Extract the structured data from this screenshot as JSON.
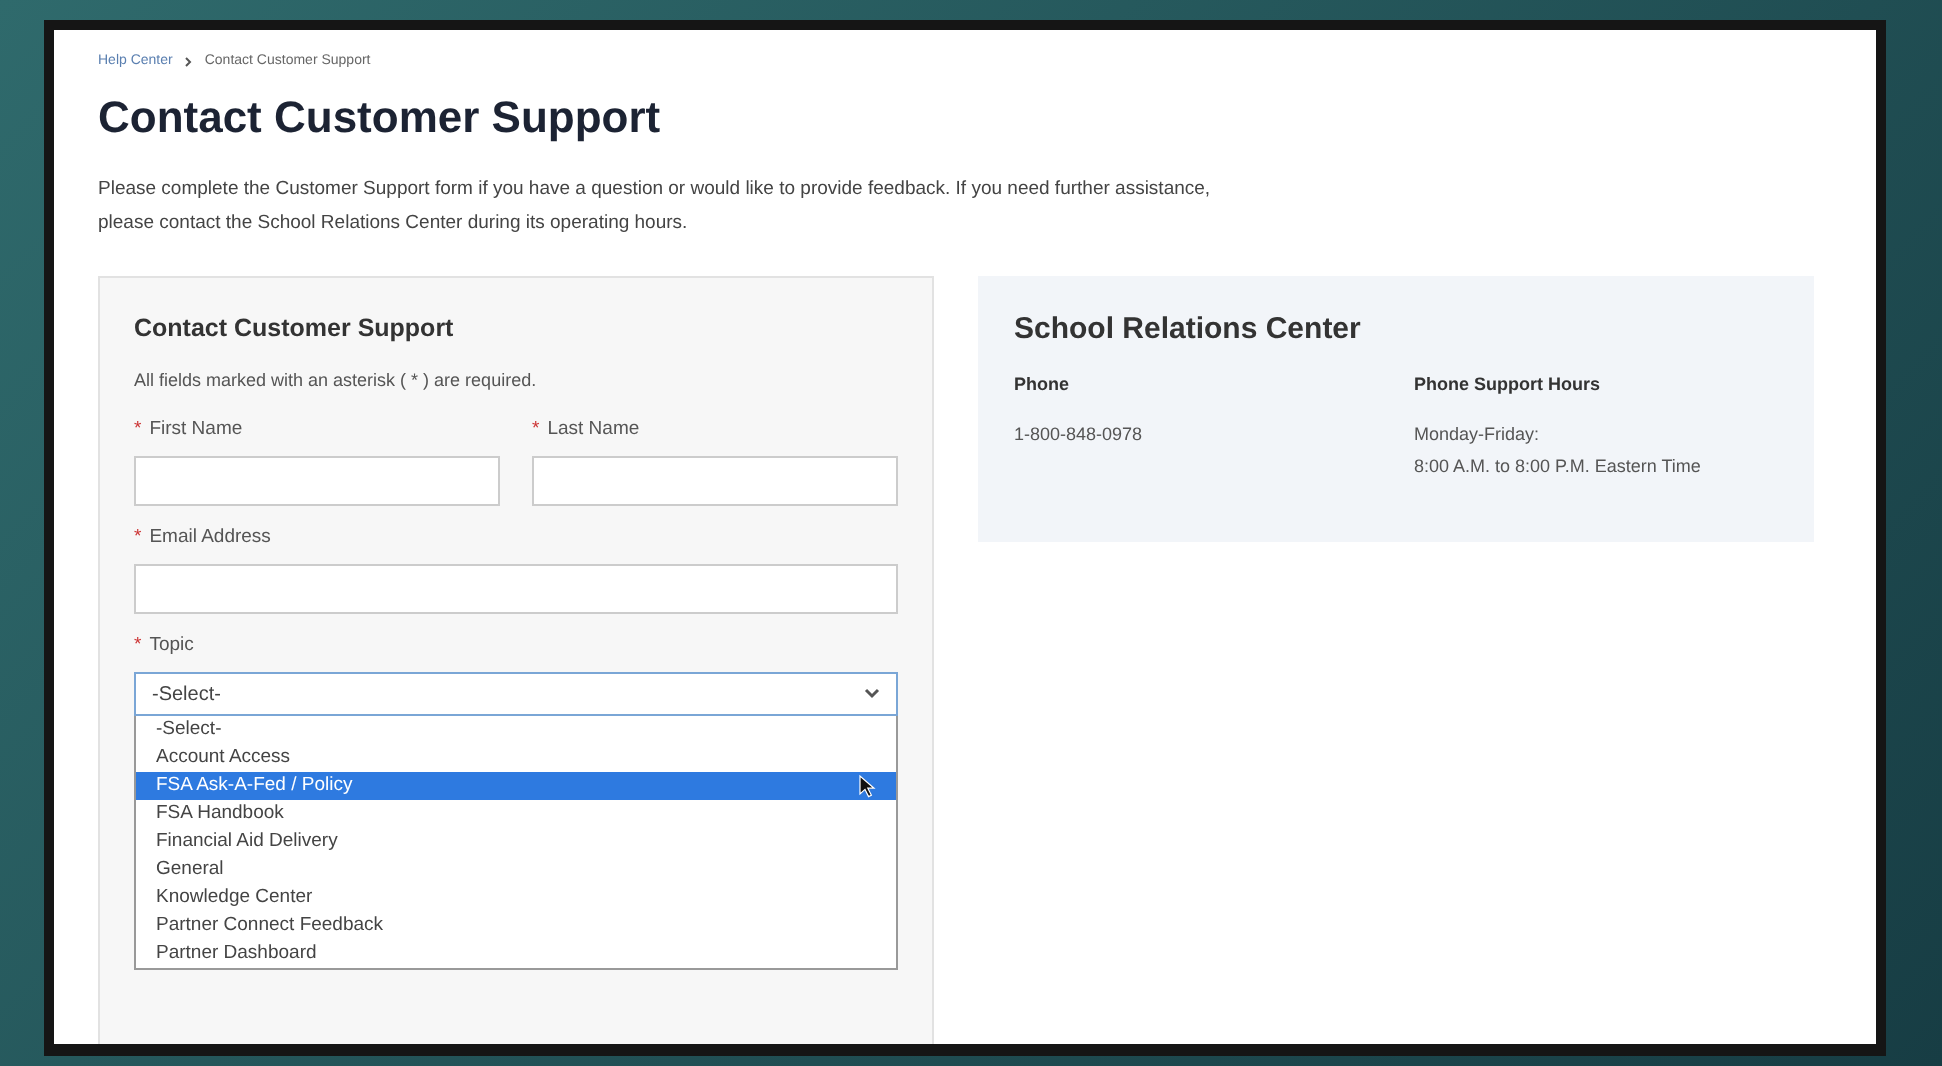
{
  "breadcrumb": [
    {
      "label": "Help Center",
      "kind": "link"
    },
    {
      "label": "Contact Customer Support",
      "kind": "current"
    }
  ],
  "title": "Contact Customer Support",
  "intro": "Please complete the Customer Support form if you have a question or would like to provide feedback. If you need further assistance, please contact the School Relations Center during its operating hours.",
  "form": {
    "title": "Contact Customer Support",
    "required_mark": "*",
    "note": "All fields marked with an asterisk ( * ) are required.",
    "fields": [
      {
        "label": "First Name",
        "required": true,
        "kind": "text"
      },
      {
        "label": "Last Name",
        "required": true,
        "kind": "text"
      },
      {
        "label": "Email Address",
        "required": true,
        "kind": "text"
      },
      {
        "label": "Topic",
        "required": true,
        "kind": "select",
        "value": "-Select-",
        "expanded": true
      }
    ],
    "options": [
      {
        "label": "-Select-",
        "selected": false
      },
      {
        "label": "Account Access",
        "selected": false
      },
      {
        "label": "FSA Ask-A-Fed / Policy",
        "selected": true
      },
      {
        "label": "FSA Handbook",
        "selected": false
      },
      {
        "label": "Financial Aid Delivery",
        "selected": false
      },
      {
        "label": "General",
        "selected": false
      },
      {
        "label": "Knowledge Center",
        "selected": false
      },
      {
        "label": "Partner Connect Feedback",
        "selected": false
      },
      {
        "label": "Partner Dashboard",
        "selected": false
      }
    ]
  },
  "info": {
    "title": "School Relations Center",
    "columns": [
      {
        "heading": "Phone",
        "lines": [
          "1-800-848-0978"
        ]
      },
      {
        "heading": "Phone Support Hours",
        "lines": [
          "Monday-Friday:",
          "8:00 A.M. to 8:00 P.M. Eastern Time"
        ]
      }
    ]
  }
}
